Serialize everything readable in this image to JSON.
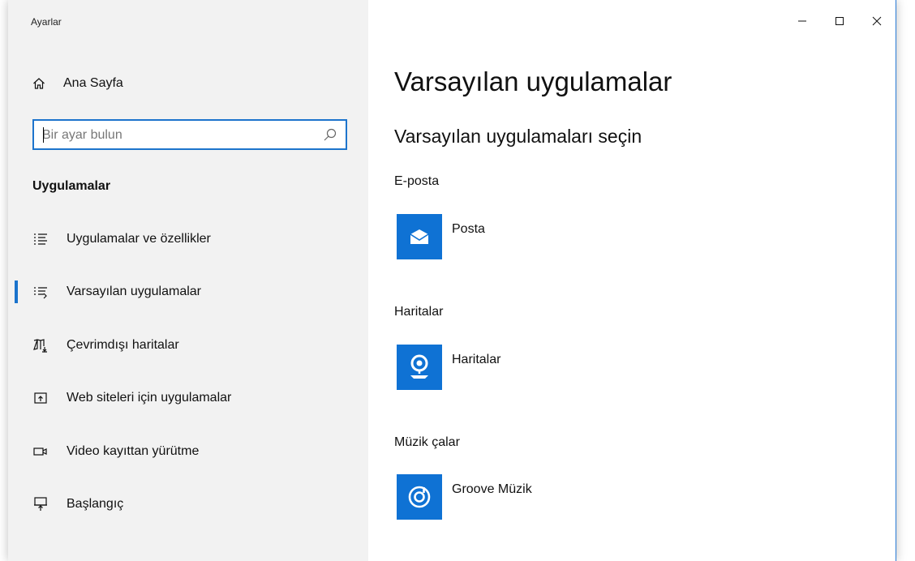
{
  "window": {
    "title": "Ayarlar",
    "controls": {
      "minimize": "—",
      "maximize": "☐",
      "close": "✕"
    }
  },
  "sidebar": {
    "home_label": "Ana Sayfa",
    "search": {
      "placeholder": "Bir ayar bulun",
      "value": ""
    },
    "section_title": "Uygulamalar",
    "items": [
      {
        "label": "Uygulamalar ve özellikler",
        "icon": "apps-features-icon",
        "active": false
      },
      {
        "label": "Varsayılan uygulamalar",
        "icon": "default-apps-icon",
        "active": true
      },
      {
        "label": "Çevrimdışı haritalar",
        "icon": "offline-maps-icon",
        "active": false
      },
      {
        "label": "Web siteleri için uygulamalar",
        "icon": "apps-for-websites-icon",
        "active": false
      },
      {
        "label": "Video kayıttan yürütme",
        "icon": "video-playback-icon",
        "active": false
      },
      {
        "label": "Başlangıç",
        "icon": "startup-icon",
        "active": false
      }
    ]
  },
  "main": {
    "title": "Varsayılan uygulamalar",
    "subtitle": "Varsayılan uygulamaları seçin",
    "categories": [
      {
        "label": "E-posta",
        "app_name": "Posta",
        "icon": "mail-icon"
      },
      {
        "label": "Haritalar",
        "app_name": "Haritalar",
        "icon": "maps-icon"
      },
      {
        "label": "Müzik çalar",
        "app_name": "Groove Müzik",
        "icon": "groove-music-icon"
      }
    ]
  },
  "colors": {
    "accent": "#0f72d4",
    "sidebar_bg": "#f2f2f2",
    "active_indicator": "#1a73cc"
  }
}
